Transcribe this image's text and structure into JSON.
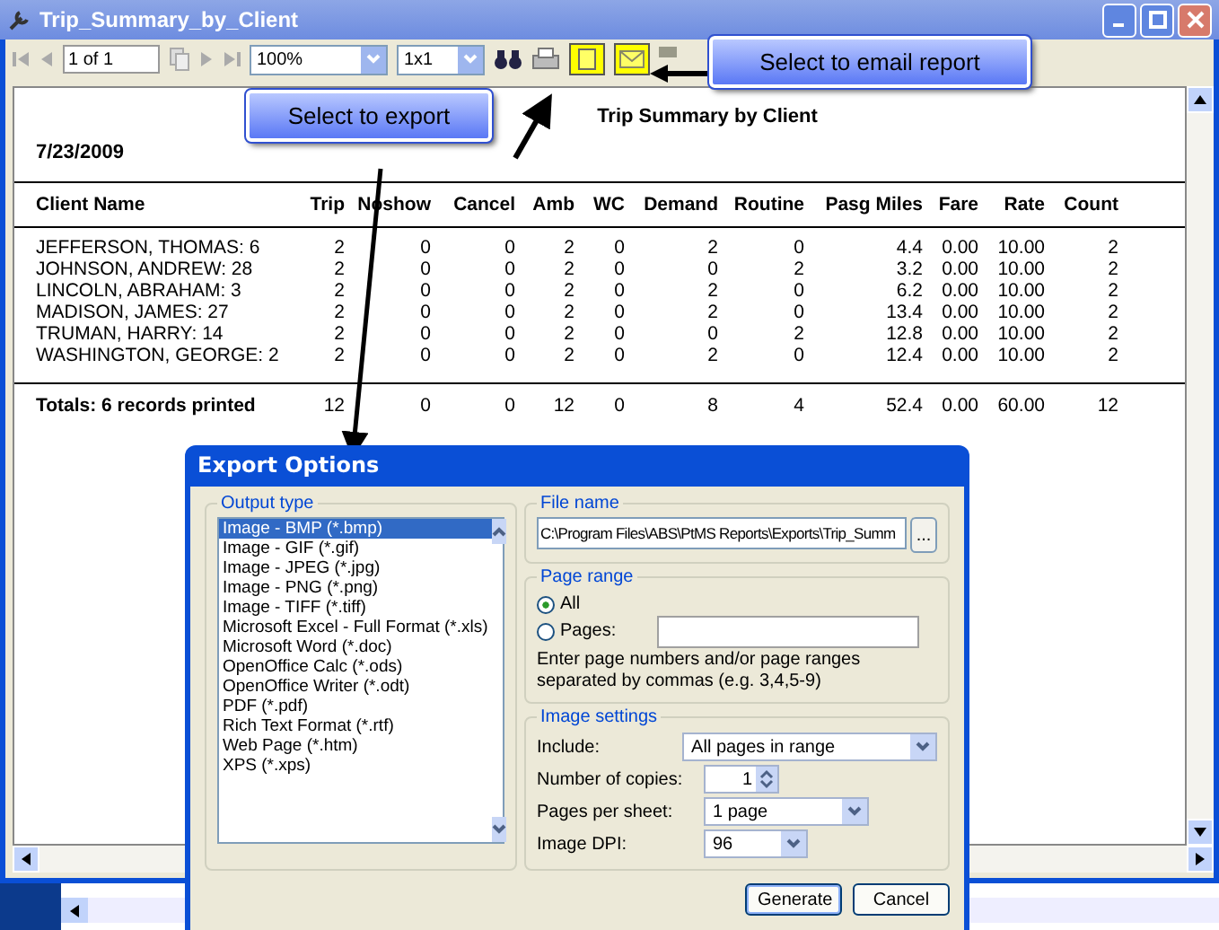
{
  "window": {
    "title": "Trip_Summary_by_Client"
  },
  "toolbar": {
    "page": "1 of 1",
    "zoom": "100%",
    "layout": "1x1",
    "export_highlighted": true,
    "email_highlighted": true
  },
  "callouts": [
    {
      "text": "Select to email report",
      "kind": "email"
    },
    {
      "text": "Select to export",
      "kind": "export"
    }
  ],
  "report": {
    "title": "Trip Summary by Client",
    "date": "7/23/2009",
    "columns": [
      "Client Name",
      "Trip",
      "Noshow",
      "Cancel",
      "Amb",
      "WC",
      "Demand",
      "Routine",
      "Pasg Miles",
      "Fare",
      "Rate",
      "Count"
    ],
    "rows": [
      [
        "JEFFERSON, THOMAS:  6",
        "2",
        "0",
        "0",
        "2",
        "0",
        "2",
        "0",
        "4.4",
        "0.00",
        "10.00",
        "2"
      ],
      [
        "JOHNSON, ANDREW:  28",
        "2",
        "0",
        "0",
        "2",
        "0",
        "0",
        "2",
        "3.2",
        "0.00",
        "10.00",
        "2"
      ],
      [
        "LINCOLN, ABRAHAM:  3",
        "2",
        "0",
        "0",
        "2",
        "0",
        "2",
        "0",
        "6.2",
        "0.00",
        "10.00",
        "2"
      ],
      [
        "MADISON, JAMES:  27",
        "2",
        "0",
        "0",
        "2",
        "0",
        "2",
        "0",
        "13.4",
        "0.00",
        "10.00",
        "2"
      ],
      [
        "TRUMAN, HARRY:  14",
        "2",
        "0",
        "0",
        "2",
        "0",
        "0",
        "2",
        "12.8",
        "0.00",
        "10.00",
        "2"
      ],
      [
        "WASHINGTON, GEORGE:  2",
        "2",
        "0",
        "0",
        "2",
        "0",
        "2",
        "0",
        "12.4",
        "0.00",
        "10.00",
        "2"
      ]
    ],
    "totals": [
      "Totals: 6 records printed",
      "12",
      "0",
      "0",
      "12",
      "0",
      "8",
      "4",
      "52.4",
      "0.00",
      "60.00",
      "12"
    ]
  },
  "dialog": {
    "title": "Export Options",
    "output_type": {
      "label": "Output type",
      "items": [
        {
          "label": "Image - BMP (*.bmp)",
          "selected": true
        },
        {
          "label": "Image - GIF (*.gif)",
          "selected": false
        },
        {
          "label": "Image - JPEG (*.jpg)",
          "selected": false
        },
        {
          "label": "Image - PNG (*.png)",
          "selected": false
        },
        {
          "label": "Image - TIFF (*.tiff)",
          "selected": false
        },
        {
          "label": "Microsoft Excel - Full Format (*.xls)",
          "selected": false
        },
        {
          "label": "Microsoft Word (*.doc)",
          "selected": false
        },
        {
          "label": "OpenOffice Calc (*.ods)",
          "selected": false
        },
        {
          "label": "OpenOffice Writer (*.odt)",
          "selected": false
        },
        {
          "label": "PDF (*.pdf)",
          "selected": false
        },
        {
          "label": "Rich Text Format (*.rtf)",
          "selected": false
        },
        {
          "label": "Web Page (*.htm)",
          "selected": false
        },
        {
          "label": "XPS (*.xps)",
          "selected": false
        }
      ]
    },
    "file_name": {
      "label": "File name",
      "value": "C:\\Program Files\\ABS\\PtMS Reports\\Exports\\Trip_Summ",
      "browse": "..."
    },
    "page_range": {
      "label": "Page range",
      "options": [
        {
          "label": "All",
          "selected": true
        },
        {
          "label": "Pages:",
          "selected": false
        }
      ],
      "note": "Enter page numbers and/or page ranges separated by commas (e.g. 3,4,5-9)"
    },
    "image_settings": {
      "label": "Image settings",
      "fields": [
        {
          "label": "Include:",
          "kind": "dropdown",
          "value": "All pages in range"
        },
        {
          "label": "Number of copies:",
          "kind": "spinner",
          "value": "1"
        },
        {
          "label": "Pages per sheet:",
          "kind": "dropdown",
          "value": "1 page"
        },
        {
          "label": "Image DPI:",
          "kind": "dropdown",
          "value": "96"
        }
      ]
    },
    "buttons": [
      "Generate",
      "Cancel"
    ]
  }
}
